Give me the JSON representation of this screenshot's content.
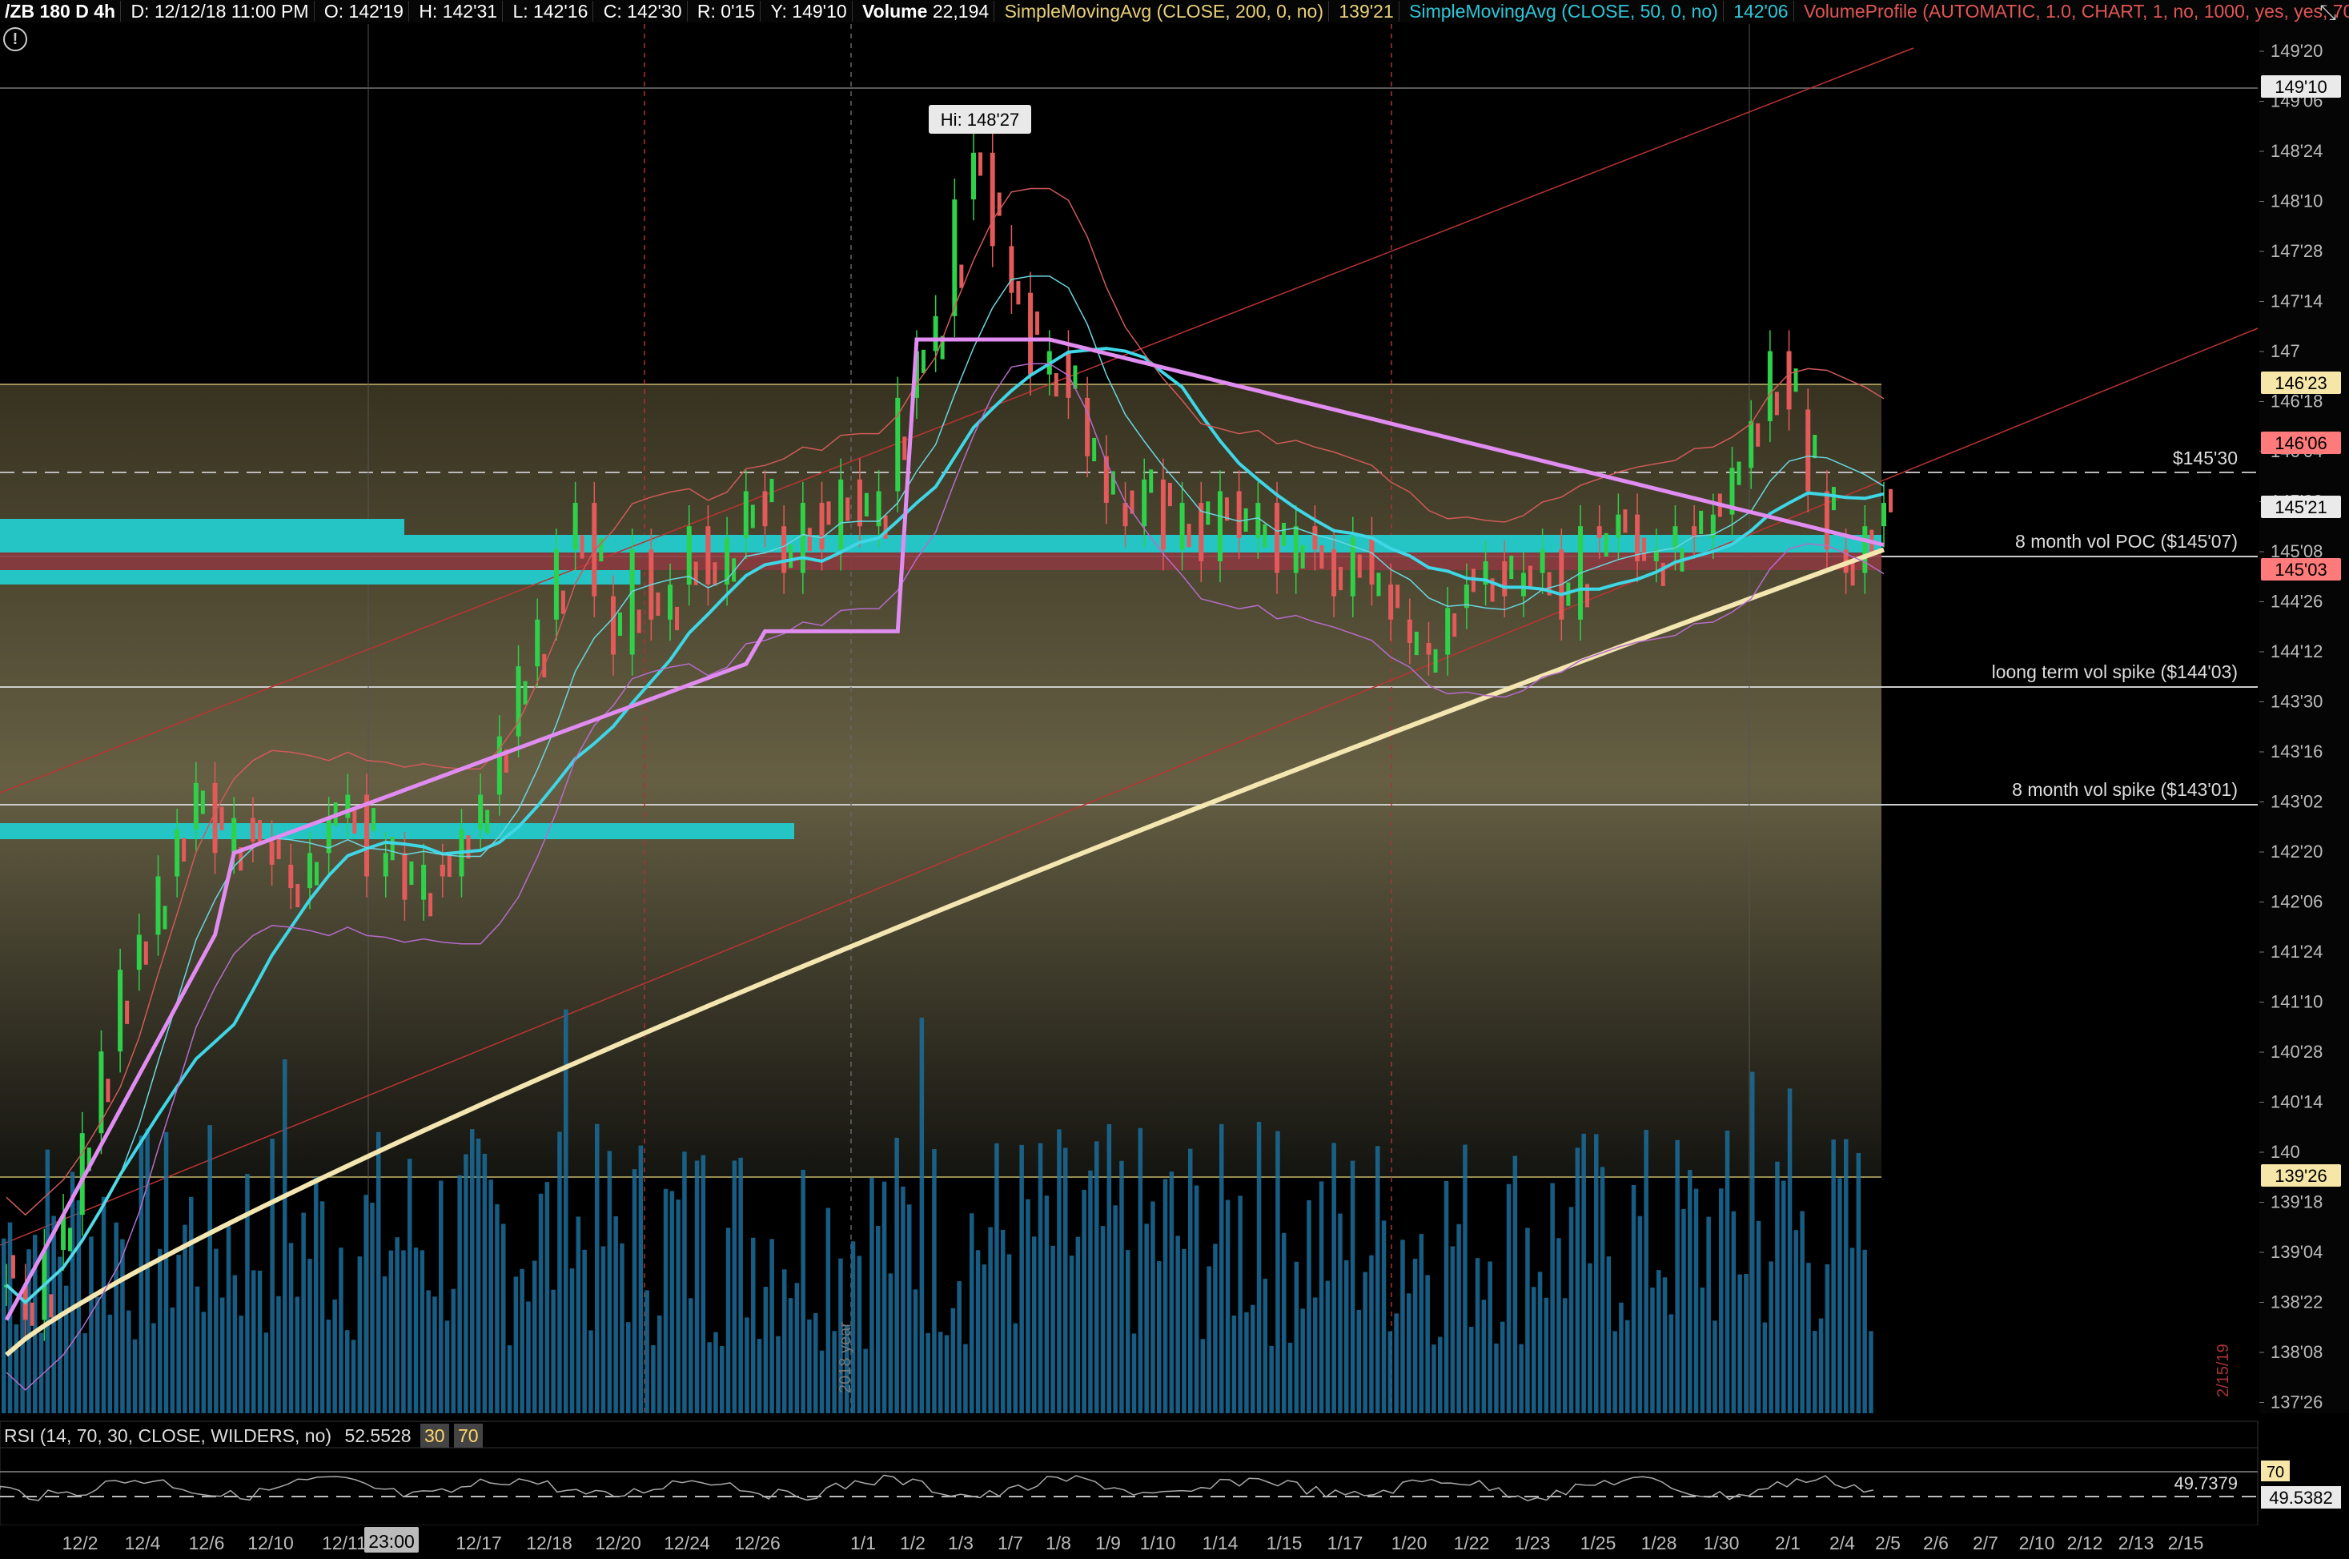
{
  "header": {
    "symbol": "/ZB 180 D 4h",
    "date": "D: 12/12/18 11:00 PM",
    "open": "O: 142'19",
    "high": "H: 142'31",
    "low": "L: 142'16",
    "close": "C: 142'30",
    "range": "R: 0'15",
    "y": "Y: 149'10",
    "volume_label": "Volume",
    "volume_value": "22,194",
    "sma200_label": "SimpleMovingAvg (CLOSE, 200, 0, no)",
    "sma200_value": "139'21",
    "sma50_label": "SimpleMovingAvg (CLOSE, 50, 0, no)",
    "sma50_value": "142'06",
    "vp_label": "VolumeProfile (AUTOMATIC, 1.0, CHART, 1, no, 1000, yes, yes, 70,..."
  },
  "rsi_header": {
    "label": "RSI (14, 70, 30, CLOSE, WILDERS, no)",
    "value": "52.5528",
    "oversold": "30",
    "overbought": "70"
  },
  "colors": {
    "background": "#000000",
    "candle_up": "#2fd04a",
    "candle_down": "#e25a5a",
    "sma200": "#f3e6b0",
    "sma50": "#3fd6e6",
    "vwap": "#e08cf0",
    "volume": "#1b6d9a",
    "vol_profile": "#25c5c5",
    "poc": "#cc4444"
  },
  "chart_data": {
    "type": "candlestick",
    "x_ticks": [
      "12/2",
      "12/4",
      "12/6",
      "12/10",
      "12/11",
      "12/17",
      "12/18",
      "12/20",
      "12/24",
      "12/26",
      "1/1",
      "1/2",
      "1/3",
      "1/7",
      "1/8",
      "1/9",
      "1/10",
      "1/14",
      "1/15",
      "1/17",
      "1/20",
      "1/22",
      "1/23",
      "1/25",
      "1/28",
      "1/30",
      "2/1",
      "2/4",
      "2/5",
      "2/6",
      "2/7",
      "2/10",
      "2/12",
      "2/13",
      "2/15"
    ],
    "x_cursor_label": "23:00",
    "y_ticks": [
      "149'20",
      "149'06",
      "148'24",
      "148'10",
      "147'28",
      "147'14",
      "147",
      "146'18",
      "146'04",
      "145'22",
      "145'08",
      "144'26",
      "144'12",
      "143'30",
      "143'16",
      "143'02",
      "142'20",
      "142'06",
      "141'24",
      "141'10",
      "140'28",
      "140'14",
      "140",
      "139'18",
      "139'04",
      "138'22",
      "138'08",
      "137'26"
    ],
    "y_badges": [
      {
        "label": "149'10",
        "style": "white"
      },
      {
        "label": "146'23",
        "style": "yellow"
      },
      {
        "label": "146'06",
        "style": "red"
      },
      {
        "label": "145'21",
        "style": "white"
      },
      {
        "label": "145'03",
        "style": "red"
      },
      {
        "label": "139'26",
        "style": "yellow"
      }
    ],
    "annotations": [
      {
        "text": "Hi: 148'27"
      },
      {
        "text": "$145'30"
      },
      {
        "text": "8 month vol POC ($145'07)"
      },
      {
        "text": "loong term vol spike ($144'03)"
      },
      {
        "text": "8 month  vol spike ($143'01)"
      }
    ],
    "vertical_labels": [
      "2018 year",
      "2/15/19"
    ],
    "close_path": [
      138.9,
      138.6,
      139.2,
      139.5,
      140.2,
      140.9,
      141.6,
      141.9,
      142.4,
      142.8,
      143.2,
      142.6,
      142.9,
      142.7,
      142.5,
      142.3,
      142.6,
      142.9,
      143.1,
      142.4,
      142.6,
      142.2,
      142.5,
      142.4,
      142.8,
      143.1,
      143.6,
      144.2,
      144.6,
      145.2,
      145.6,
      144.8,
      144.3,
      145.2,
      144.6,
      144.9,
      145.4,
      144.9,
      145.3,
      145.7,
      145.4,
      145.0,
      145.6,
      145.2,
      145.8,
      145.4,
      145.7,
      146.5,
      146.9,
      147.2,
      148.2,
      148.6,
      147.8,
      147.4,
      146.7,
      146.9,
      146.5,
      146.0,
      145.6,
      145.4,
      145.8,
      145.2,
      145.6,
      145.1,
      145.7,
      145.3,
      145.6,
      145.0,
      145.4,
      145.2,
      144.8,
      145.3,
      144.9,
      144.6,
      144.4,
      144.3,
      144.7,
      144.9,
      145.1,
      144.8,
      145.0,
      145.2,
      144.6,
      145.4,
      145.3,
      145.5,
      145.1,
      145.2,
      145.4,
      145.3,
      145.5,
      145.9,
      146.3,
      146.9,
      146.4,
      145.7,
      145.2,
      145.0,
      145.4,
      145.6
    ],
    "rsi": {
      "value": 52.5528,
      "levels": [
        70,
        30
      ],
      "markers": [
        "49.7379",
        "49.5382"
      ]
    }
  }
}
